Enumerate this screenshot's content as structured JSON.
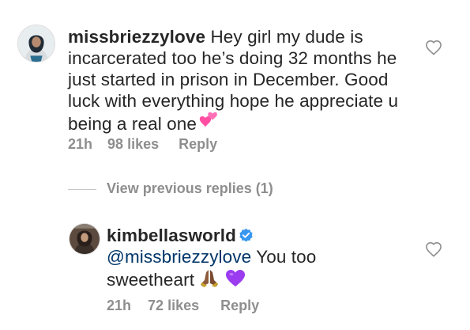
{
  "comments": [
    {
      "username": "missbriezzylove",
      "text": "Hey girl my dude is incarcerated too he’s doing 32 months he just started in prison in December. Good luck with everything hope he appreciate u being a real one",
      "time": "21h",
      "likes": "98 likes",
      "reply_label": "Reply",
      "emoji": "two-hearts",
      "like_icon": "heart-outline-icon"
    },
    {
      "username": "kimbellasworld",
      "verified": true,
      "mention": "@missbriezzylove",
      "text": "You too sweetheart",
      "time": "21h",
      "likes": "72 likes",
      "reply_label": "Reply",
      "emojis": [
        "folded-hands",
        "purple-heart"
      ],
      "like_icon": "heart-outline-icon"
    }
  ],
  "view_replies": "View previous replies (1)",
  "colors": {
    "text": "#262626",
    "meta": "#8e8e8e",
    "mention": "#003569",
    "verified": "#3897f0",
    "pink_heart": "#ff4fa3",
    "purple_heart": "#9b3cf0"
  }
}
